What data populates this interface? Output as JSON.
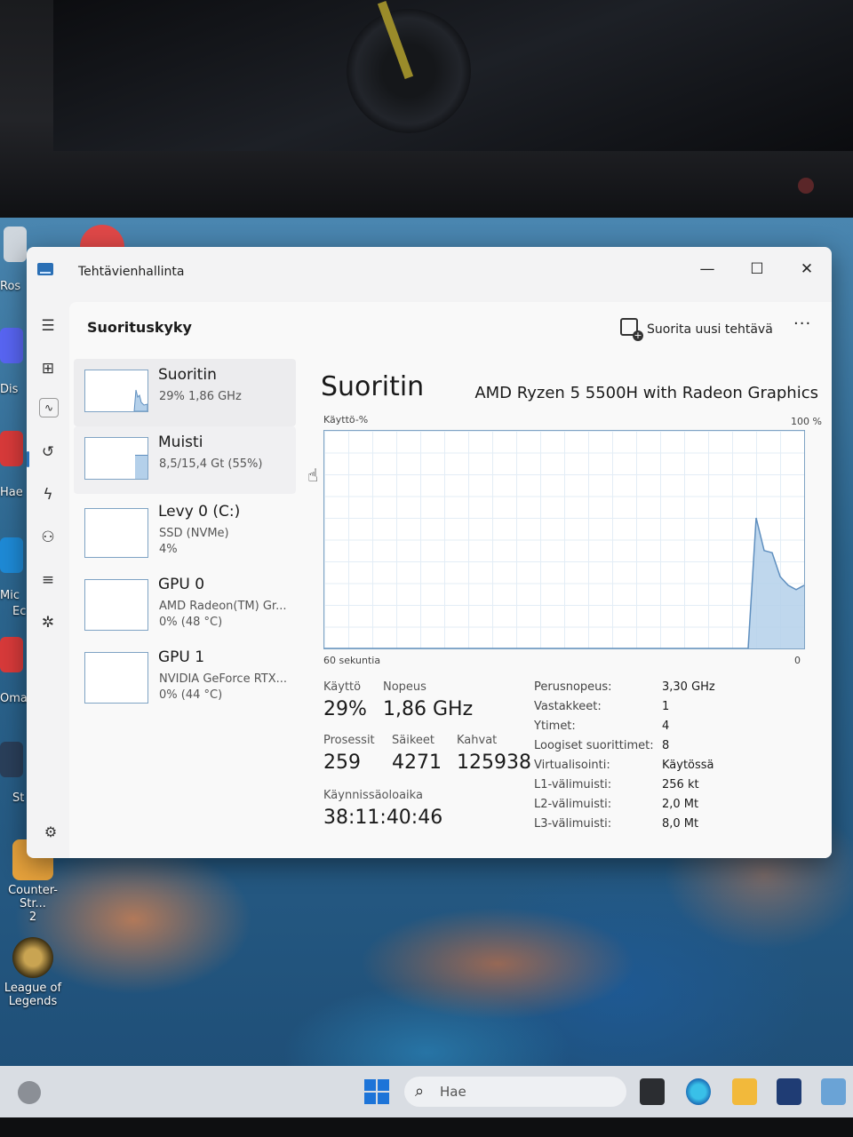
{
  "desktop": {
    "icons": [
      {
        "label": "Counter-Str...",
        "label2": "2"
      },
      {
        "label": "League of",
        "label2": "Legends"
      }
    ],
    "edge_labels": [
      "Ros",
      "Dis",
      "Hae",
      "Mic",
      "Ec",
      "Oma",
      "St"
    ]
  },
  "taskbar": {
    "search_placeholder": "Hae"
  },
  "window": {
    "title": "Tehtävienhallinta",
    "controls": {
      "minimize": "—",
      "maximize": "☐",
      "close": "✕"
    }
  },
  "header": {
    "page_title": "Suorituskyky",
    "run_task_label": "Suorita uusi tehtävä",
    "more": "···"
  },
  "resources": [
    {
      "name": "Suoritin",
      "sub1": "29%  1,86 GHz",
      "sub2": ""
    },
    {
      "name": "Muisti",
      "sub1": "8,5/15,4 Gt (55%)",
      "sub2": ""
    },
    {
      "name": "Levy 0 (C:)",
      "sub1": "SSD (NVMe)",
      "sub2": "4%"
    },
    {
      "name": "GPU 0",
      "sub1": "AMD Radeon(TM) Gr...",
      "sub2": "0%  (48 °C)"
    },
    {
      "name": "GPU 1",
      "sub1": "NVIDIA GeForce RTX...",
      "sub2": "0%  (44 °C)"
    }
  ],
  "cpu": {
    "title": "Suoritin",
    "model": "AMD Ryzen 5 5500H with Radeon Graphics",
    "usage_label": "Käyttö-%",
    "max_label": "100 %",
    "time_label": "60 sekuntia",
    "zero_label": "0",
    "stats": {
      "usage_label": "Käyttö",
      "usage": "29%",
      "speed_label": "Nopeus",
      "speed": "1,86 GHz",
      "processes_label": "Prosessit",
      "processes": "259",
      "threads_label": "Säikeet",
      "threads": "4271",
      "handles_label": "Kahvat",
      "handles": "125938",
      "uptime_label": "Käynnissäoloaika",
      "uptime": "38:11:40:46"
    },
    "details": [
      {
        "key": "Perusnopeus:",
        "value": "3,30 GHz"
      },
      {
        "key": "Vastakkeet:",
        "value": "1"
      },
      {
        "key": "Ytimet:",
        "value": "4"
      },
      {
        "key": "Loogiset suorittimet:",
        "value": "8"
      },
      {
        "key": "Virtualisointi:",
        "value": "Käytössä"
      },
      {
        "key": "L1-välimuisti:",
        "value": "256 kt"
      },
      {
        "key": "L2-välimuisti:",
        "value": "2,0 Mt"
      },
      {
        "key": "L3-välimuisti:",
        "value": "8,0 Mt"
      }
    ]
  },
  "chart_data": {
    "type": "area",
    "xlabel": "60 sekuntia",
    "ylabel": "Käyttö-%",
    "x": [
      60,
      55,
      50,
      45,
      40,
      35,
      30,
      28,
      27,
      26,
      25,
      24,
      23,
      22,
      21,
      20,
      19,
      18,
      17,
      16,
      15,
      14,
      13,
      12,
      11,
      10,
      9,
      8,
      7,
      6,
      5,
      4,
      3,
      2,
      1,
      0
    ],
    "values": [
      0,
      0,
      0,
      0,
      0,
      0,
      0,
      0,
      0,
      0,
      0,
      0,
      0,
      0,
      0,
      0,
      0,
      0,
      0,
      0,
      0,
      0,
      0,
      0,
      0,
      0,
      0,
      0,
      0,
      60,
      45,
      44,
      33,
      29,
      27,
      29
    ],
    "ylim": [
      0,
      100
    ],
    "xlim": [
      60,
      0
    ],
    "color": "#b4d0ea",
    "line_color": "#5f8fbf"
  },
  "colors": {
    "accent": "#2a6fb5",
    "graph_fill": "#b4d0ea",
    "graph_border": "#7fa3c4"
  }
}
